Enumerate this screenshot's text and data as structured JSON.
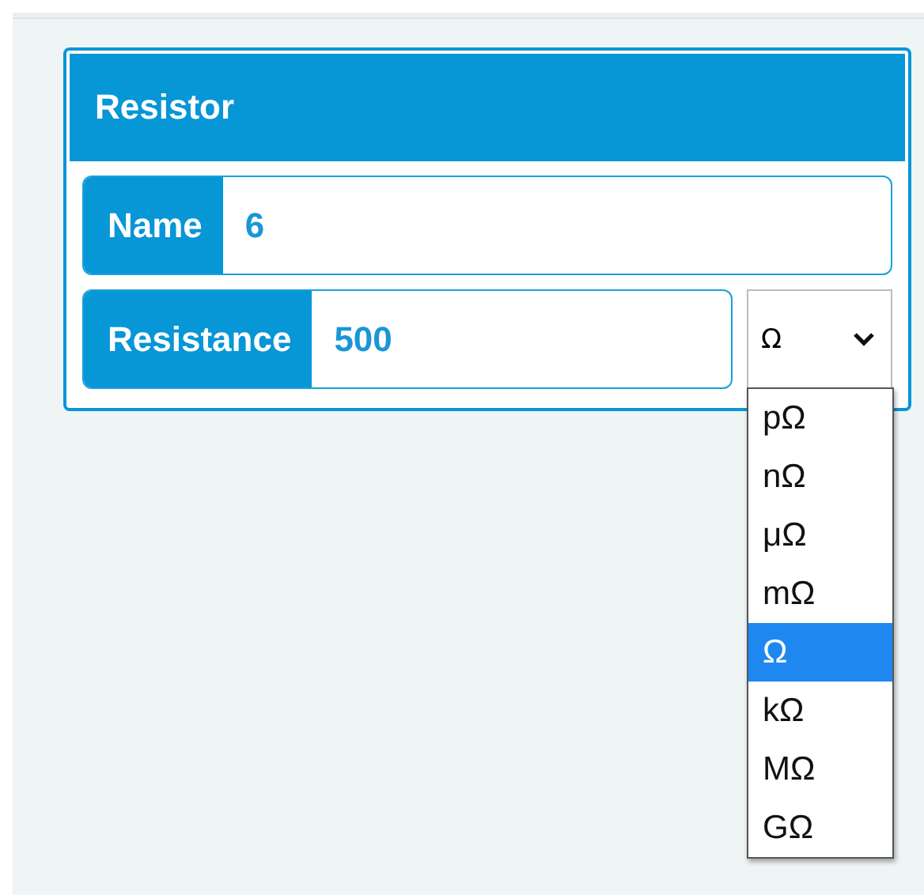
{
  "panel": {
    "title": "Resistor"
  },
  "fields": [
    {
      "label": "Name",
      "value": "6"
    },
    {
      "label": "Resistance",
      "value": "500"
    }
  ],
  "unit_select": {
    "value": "Ω",
    "expanded": true,
    "options": [
      {
        "label": "pΩ",
        "selected": false
      },
      {
        "label": "nΩ",
        "selected": false
      },
      {
        "label": "μΩ",
        "selected": false
      },
      {
        "label": "mΩ",
        "selected": false
      },
      {
        "label": "Ω",
        "selected": true
      },
      {
        "label": "kΩ",
        "selected": false
      },
      {
        "label": "MΩ",
        "selected": false
      },
      {
        "label": "GΩ",
        "selected": false
      }
    ]
  }
}
